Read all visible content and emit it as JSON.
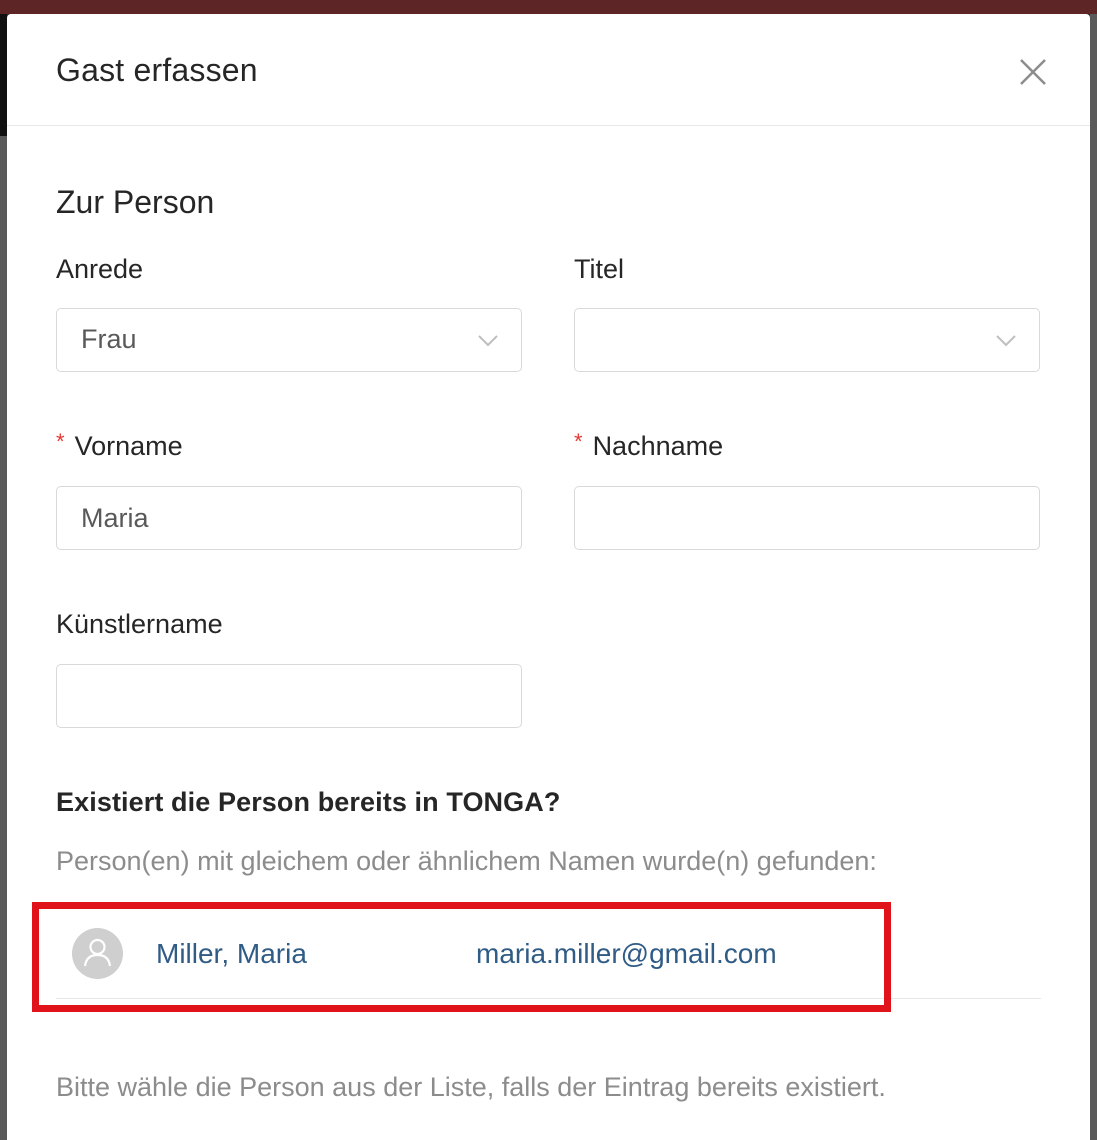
{
  "modal": {
    "title": "Gast erfassen",
    "close_icon": "close-icon"
  },
  "section": {
    "title": "Zur Person"
  },
  "fields": {
    "anrede": {
      "label": "Anrede",
      "value": "Frau",
      "icon": "chevron-down-icon"
    },
    "titel": {
      "label": "Titel",
      "value": "",
      "icon": "chevron-down-icon"
    },
    "vorname": {
      "label": "Vorname",
      "required_marker": "*",
      "value": "Maria"
    },
    "nachname": {
      "label": "Nachname",
      "required_marker": "*",
      "value": ""
    },
    "kuenstlername": {
      "label": "Künstlername",
      "value": ""
    }
  },
  "duplicate_check": {
    "question": "Existiert die Person bereits in TONGA?",
    "found_text": "Person(en) mit gleichem oder ähnlichem Namen wurde(n) gefunden:",
    "results": [
      {
        "name": "Miller, Maria",
        "email": "maria.miller@gmail.com",
        "avatar_icon": "user-avatar-icon"
      }
    ],
    "hint": "Bitte wähle die Person aus der Liste, falls der Eintrag bereits existiert."
  },
  "colors": {
    "link": "#2f5b85",
    "required": "#e53935",
    "highlight": "#e0121a",
    "backdrop_top": "#5e2526"
  }
}
